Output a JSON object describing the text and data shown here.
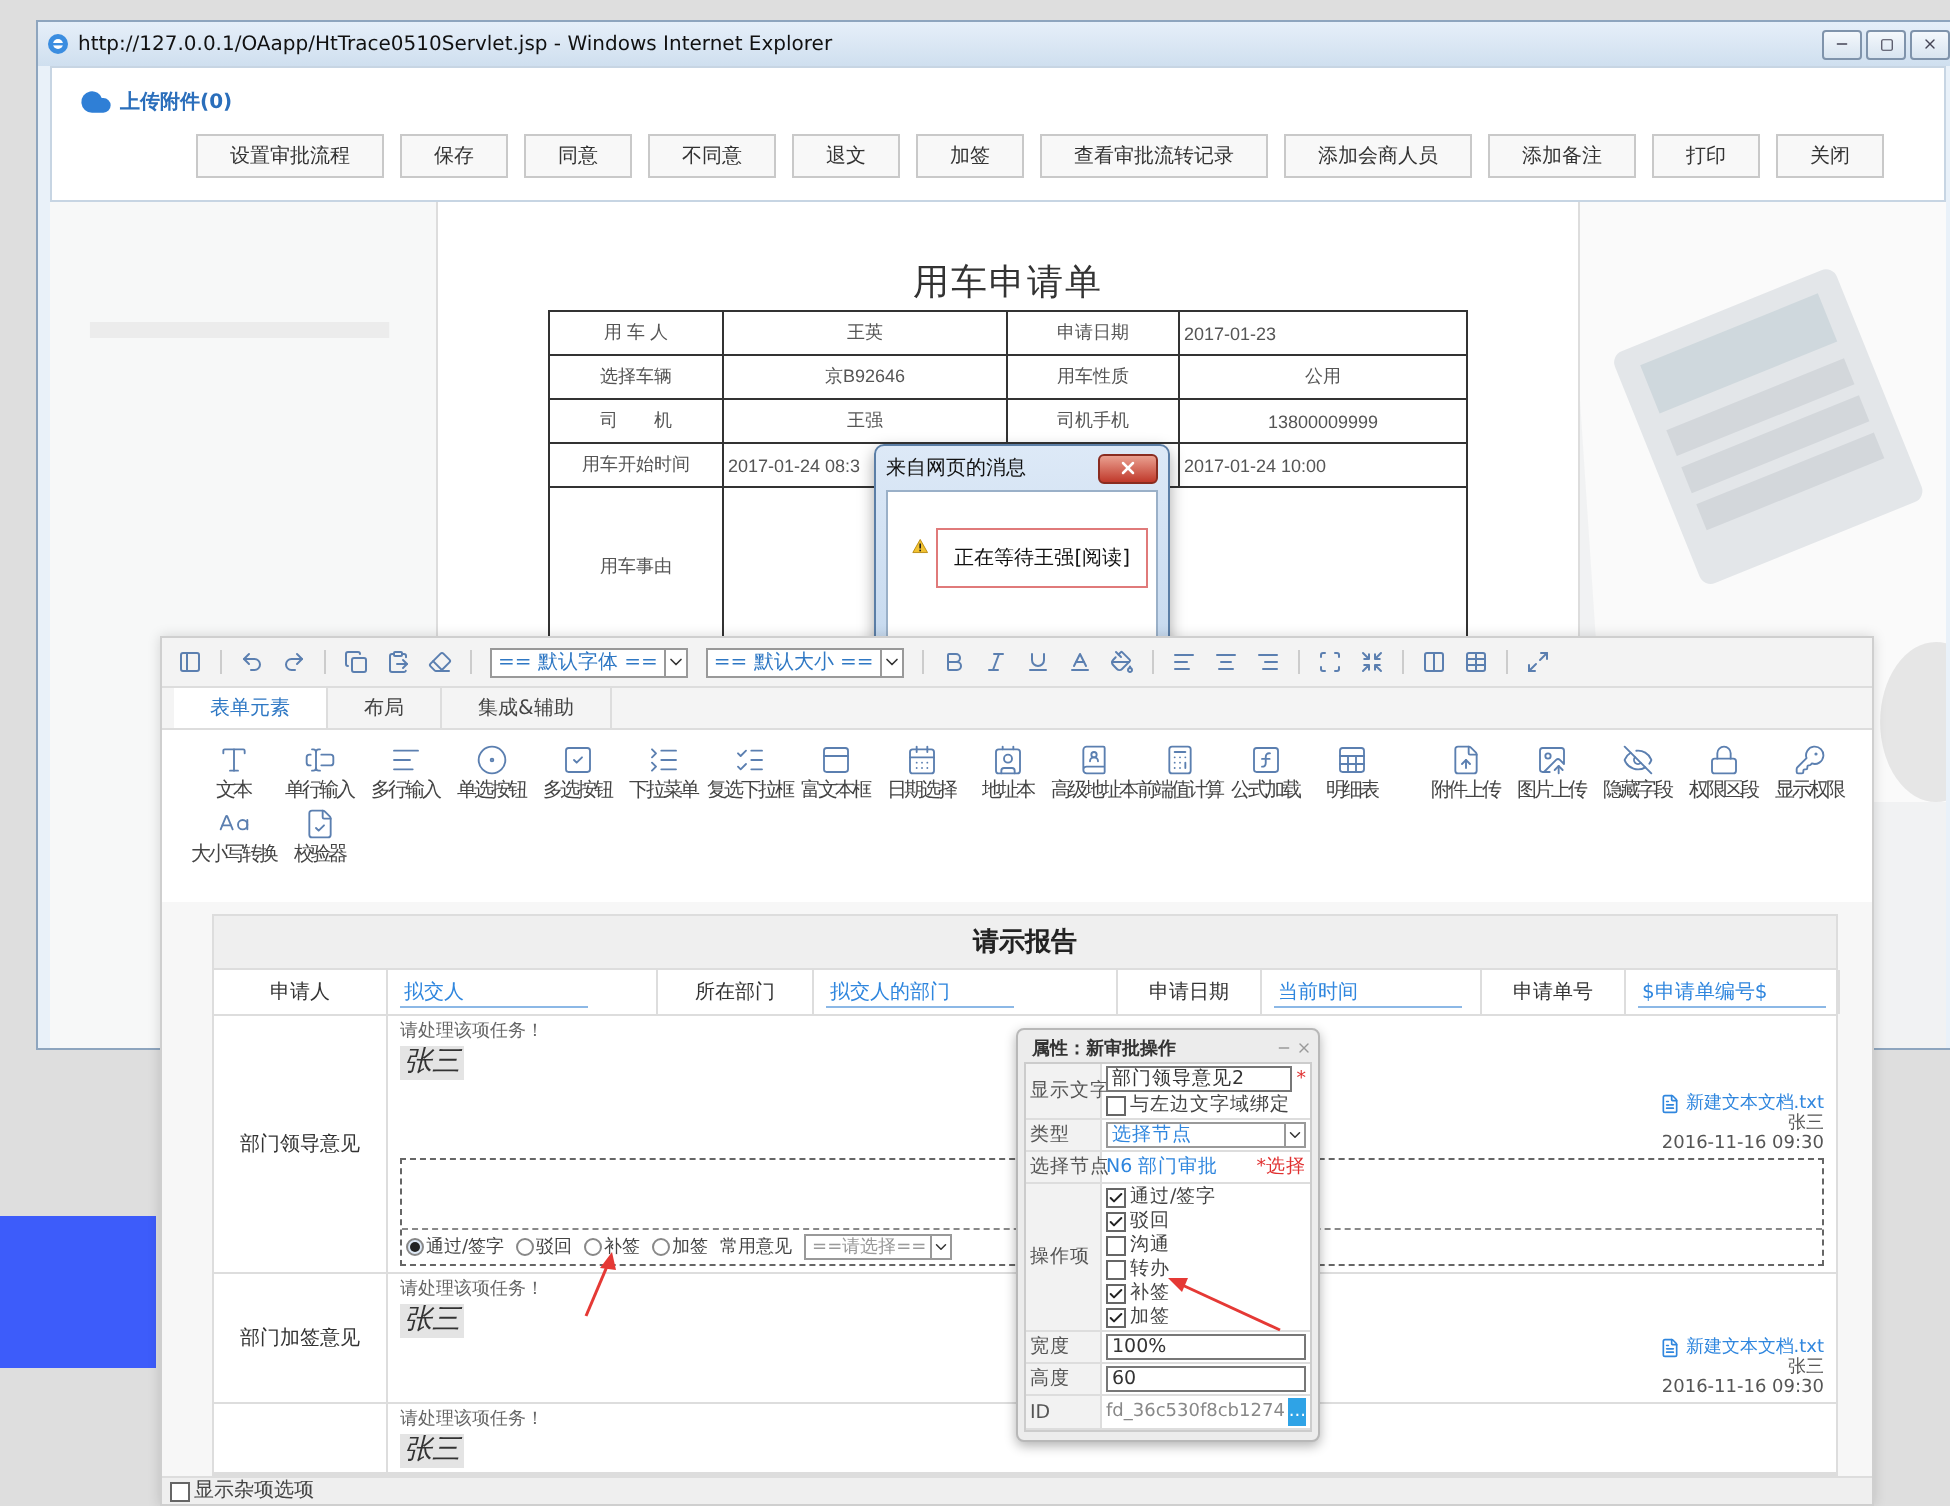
{
  "browser": {
    "title": "http://127.0.0.1/OAapp/HtTrace0510Servlet.jsp - Windows Internet Explorer",
    "upload_link": "上传附件(0)",
    "buttons": [
      "设置审批流程",
      "保存",
      "同意",
      "不同意",
      "退文",
      "加签",
      "查看审批流转记录",
      "添加会商人员",
      "添加备注",
      "打印",
      "关闭"
    ],
    "form": {
      "title": "用车申请单",
      "rows": [
        {
          "cells": [
            {
              "kind": "label",
              "text": "用 车 人"
            },
            {
              "kind": "text",
              "text": "王英"
            },
            {
              "kind": "label",
              "text": "申请日期"
            },
            {
              "kind": "datetime",
              "text": "2017-01-23"
            }
          ]
        },
        {
          "cells": [
            {
              "kind": "label",
              "text": "选择车辆"
            },
            {
              "kind": "text",
              "text": "京B92646"
            },
            {
              "kind": "label",
              "text": "用车性质"
            },
            {
              "kind": "text",
              "text": "公用"
            }
          ]
        },
        {
          "cells": [
            {
              "kind": "label",
              "text": "司　　机"
            },
            {
              "kind": "text",
              "text": "王强"
            },
            {
              "kind": "label",
              "text": "司机手机"
            },
            {
              "kind": "text",
              "text": "13800009999"
            }
          ]
        },
        {
          "cells": [
            {
              "kind": "label",
              "text": "用车开始时间"
            },
            {
              "kind": "datetime",
              "text": "2017-01-24 08:3"
            },
            {
              "kind": "label"
            },
            {
              "kind": "datetime",
              "text": "2017-01-24 10:00"
            }
          ]
        },
        {
          "cells": [
            {
              "kind": "label",
              "text": "用车事由"
            },
            {
              "kind": "wide"
            }
          ]
        }
      ]
    }
  },
  "message_dialog": {
    "title": "来自网页的消息",
    "message": "正在等待王强[阅读]"
  },
  "designer": {
    "font_select": "== 默认字体 ==",
    "size_select": "== 默认大小 ==",
    "tabs": [
      {
        "label": "表单元素",
        "selected": true
      },
      {
        "label": "布局",
        "selected": false
      },
      {
        "label": "集成&辅助",
        "selected": false
      }
    ],
    "palette": {
      "rows": [
        {
          "groups": [
            {
              "items": [
                "文本",
                "单行输入",
                "多行输入",
                "单选按钮",
                "多选按钮",
                "下拉菜单",
                "复选下拉框",
                "富文本框",
                "日期选择",
                "地址本",
                "高级地址本",
                "前端值计算",
                "公式加载",
                "明细表"
              ]
            },
            {
              "items": [
                "附件上传",
                "图片上传",
                "隐藏字段",
                "权限区段",
                "显示权限"
              ]
            }
          ]
        },
        {
          "groups": [
            {
              "items": [
                "大小写转换",
                "校验器"
              ]
            }
          ]
        }
      ]
    },
    "form": {
      "title": "请示报告",
      "header_fields": [
        {
          "label": "申请人",
          "value": "拟交人"
        },
        {
          "label": "所在部门",
          "value": "拟交人的部门"
        },
        {
          "label": "申请日期",
          "value": "当前时间"
        },
        {
          "label": "申请单号",
          "value": "$申请单编号$"
        }
      ],
      "opinion_rows": [
        {
          "label": "部门领导意见",
          "prompt": "请处理该项任务！",
          "signature": "张三",
          "attachment": "新建文本文档.txt",
          "signer": "张三",
          "time": "2016-11-16 09:30",
          "editor": {
            "options": [
              {
                "label": "通过/签字",
                "selected": true
              },
              {
                "label": "驳回",
                "selected": false
              },
              {
                "label": "补签",
                "selected": false
              },
              {
                "label": "加签",
                "selected": false
              }
            ],
            "common_label": "常用意见",
            "select": "==请选择=="
          }
        },
        {
          "label": "部门加签意见",
          "prompt": "请处理该项任务！",
          "signature": "张三",
          "attachment": "新建文本文档.txt",
          "signer": "张三",
          "time": "2016-11-16 09:30"
        },
        {
          "prompt": "请处理该项任务！",
          "signature": "张三"
        }
      ]
    },
    "footer": {
      "label": "显示杂项选项",
      "checked": false
    }
  },
  "properties": {
    "title": "属性：新审批操作",
    "display_text": {
      "label": "显示文字",
      "value": "部门领导意见2",
      "required_mark": "*",
      "bind_label": "与左边文字域绑定",
      "bind_checked": false
    },
    "type": {
      "label": "类型",
      "value": "选择节点"
    },
    "node": {
      "label": "选择节点",
      "value": "N6 部门审批",
      "action": "*选择"
    },
    "operations": {
      "label": "操作项",
      "options": [
        {
          "label": "通过/签字",
          "checked": true
        },
        {
          "label": "驳回",
          "checked": true
        },
        {
          "label": "沟通",
          "checked": false
        },
        {
          "label": "转办",
          "checked": false
        },
        {
          "label": "补签",
          "checked": true
        },
        {
          "label": "加签",
          "checked": true
        }
      ]
    },
    "width": {
      "label": "宽度",
      "value": "100%"
    },
    "height": {
      "label": "高度",
      "value": "60"
    },
    "id": {
      "label": "ID",
      "value": "fd_36c530f8cb1274",
      "button": "..."
    }
  }
}
